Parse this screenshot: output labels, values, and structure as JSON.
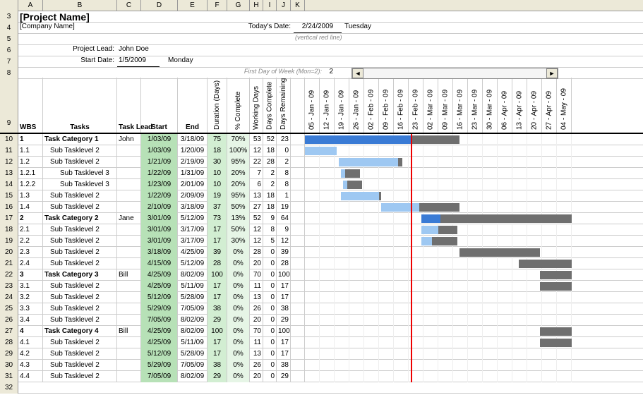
{
  "col_letters": [
    "A",
    "B",
    "C",
    "D",
    "E",
    "F",
    "G",
    "H",
    "I",
    "J",
    "K"
  ],
  "header": {
    "project_name": "[Project Name]",
    "company_name": "[Company Name]",
    "todays_date_label": "Today's Date:",
    "todays_date": "2/24/2009",
    "todays_day": "Tuesday",
    "vertical_note": "(vertical red line)",
    "project_lead_label": "Project Lead:",
    "project_lead": "John Doe",
    "start_date_label": "Start Date:",
    "start_date": "1/5/2009",
    "start_day": "Monday",
    "first_dow_label": "First Day of Week (Mon=2):",
    "first_dow_value": "2"
  },
  "columns": {
    "wbs": "WBS",
    "tasks": "Tasks",
    "task_lead": "Task Lead",
    "start": "Start",
    "end": "End",
    "duration": "Duration (Days)",
    "pct": "% Complete",
    "working": "Working Days",
    "dcomp": "Days Complete",
    "drem": "Days Remaining"
  },
  "date_cols": [
    "05 - Jan - 09",
    "12 - Jan - 09",
    "19 - Jan - 09",
    "26 - Jan - 09",
    "02 - Feb - 09",
    "09 - Feb - 09",
    "16 - Feb - 09",
    "23 - Feb - 09",
    "02 - Mar - 09",
    "09 - Mar - 09",
    "16 - Mar - 09",
    "23 - Mar - 09",
    "30 - Mar - 09",
    "06 - Apr - 09",
    "13 - Apr - 09",
    "20 - Apr - 09",
    "27 - Apr - 09",
    "04 - May - 09"
  ],
  "today_index": 7.14,
  "rows": [
    {
      "rn": 10,
      "wbs": "1",
      "task": "Task Category 1",
      "lead": "John",
      "start": "1/03/09",
      "end": "3/18/09",
      "dur": "75",
      "pct": "70%",
      "wd": "53",
      "dc": "52",
      "dr": "23",
      "cat": true,
      "bars": [
        {
          "s": -0.285,
          "e": 7.14,
          "cls": "bar-blue"
        },
        {
          "s": 7.14,
          "e": 10.43,
          "cls": "bar-dark"
        }
      ]
    },
    {
      "rn": 11,
      "wbs": "1.1",
      "task": "Sub Tasklevel 2",
      "lead": "",
      "start": "1/03/09",
      "end": "1/20/09",
      "dur": "18",
      "pct": "100%",
      "wd": "12",
      "dc": "18",
      "dr": "0",
      "indent": 1,
      "bars": [
        {
          "s": -0.285,
          "e": 2.14,
          "cls": "bar-light"
        }
      ]
    },
    {
      "rn": 12,
      "wbs": "1.2",
      "task": "Sub Tasklevel 2",
      "lead": "",
      "start": "1/21/09",
      "end": "2/19/09",
      "dur": "30",
      "pct": "95%",
      "wd": "22",
      "dc": "28",
      "dr": "2",
      "indent": 1,
      "bars": [
        {
          "s": 2.28,
          "e": 6.29,
          "cls": "bar-light"
        },
        {
          "s": 6.29,
          "e": 6.57,
          "cls": "bar-dark"
        }
      ]
    },
    {
      "rn": 13,
      "wbs": "1.2.1",
      "task": "Sub Tasklevel 3",
      "lead": "",
      "start": "1/22/09",
      "end": "1/31/09",
      "dur": "10",
      "pct": "20%",
      "wd": "7",
      "dc": "2",
      "dr": "8",
      "indent": 2,
      "bars": [
        {
          "s": 2.43,
          "e": 2.71,
          "cls": "bar-light"
        },
        {
          "s": 2.71,
          "e": 3.71,
          "cls": "bar-dark"
        }
      ]
    },
    {
      "rn": 14,
      "wbs": "1.2.2",
      "task": "Sub Tasklevel 3",
      "lead": "",
      "start": "1/23/09",
      "end": "2/01/09",
      "dur": "10",
      "pct": "20%",
      "wd": "6",
      "dc": "2",
      "dr": "8",
      "indent": 2,
      "bars": [
        {
          "s": 2.57,
          "e": 2.86,
          "cls": "bar-light"
        },
        {
          "s": 2.86,
          "e": 3.86,
          "cls": "bar-dark"
        }
      ]
    },
    {
      "rn": 15,
      "wbs": "1.3",
      "task": "Sub Tasklevel 2",
      "lead": "",
      "start": "1/22/09",
      "end": "2/09/09",
      "dur": "19",
      "pct": "95%",
      "wd": "13",
      "dc": "18",
      "dr": "1",
      "indent": 1,
      "bars": [
        {
          "s": 2.43,
          "e": 5.0,
          "cls": "bar-light"
        },
        {
          "s": 5.0,
          "e": 5.14,
          "cls": "bar-dark"
        }
      ]
    },
    {
      "rn": 16,
      "wbs": "1.4",
      "task": "Sub Tasklevel 2",
      "lead": "",
      "start": "2/10/09",
      "end": "3/18/09",
      "dur": "37",
      "pct": "50%",
      "wd": "27",
      "dc": "18",
      "dr": "19",
      "indent": 1,
      "bars": [
        {
          "s": 5.14,
          "e": 7.71,
          "cls": "bar-light"
        },
        {
          "s": 7.71,
          "e": 10.43,
          "cls": "bar-dark"
        }
      ]
    },
    {
      "rn": 17,
      "wbs": "2",
      "task": "Task Category 2",
      "lead": "Jane",
      "start": "3/01/09",
      "end": "5/12/09",
      "dur": "73",
      "pct": "13%",
      "wd": "52",
      "dc": "9",
      "dr": "64",
      "cat": true,
      "bars": [
        {
          "s": 7.86,
          "e": 9.14,
          "cls": "bar-blue"
        },
        {
          "s": 9.14,
          "e": 18.0,
          "cls": "bar-dark"
        }
      ]
    },
    {
      "rn": 18,
      "wbs": "2.1",
      "task": "Sub Tasklevel 2",
      "lead": "",
      "start": "3/01/09",
      "end": "3/17/09",
      "dur": "17",
      "pct": "50%",
      "wd": "12",
      "dc": "8",
      "dr": "9",
      "indent": 1,
      "bars": [
        {
          "s": 7.86,
          "e": 9.0,
          "cls": "bar-light"
        },
        {
          "s": 9.0,
          "e": 10.28,
          "cls": "bar-dark"
        }
      ]
    },
    {
      "rn": 19,
      "wbs": "2.2",
      "task": "Sub Tasklevel 2",
      "lead": "",
      "start": "3/01/09",
      "end": "3/17/09",
      "dur": "17",
      "pct": "30%",
      "wd": "12",
      "dc": "5",
      "dr": "12",
      "indent": 1,
      "bars": [
        {
          "s": 7.86,
          "e": 8.57,
          "cls": "bar-light"
        },
        {
          "s": 8.57,
          "e": 10.28,
          "cls": "bar-dark"
        }
      ]
    },
    {
      "rn": 20,
      "wbs": "2.3",
      "task": "Sub Tasklevel 2",
      "lead": "",
      "start": "3/18/09",
      "end": "4/25/09",
      "dur": "39",
      "pct": "0%",
      "wd": "28",
      "dc": "0",
      "dr": "39",
      "indent": 1,
      "bars": [
        {
          "s": 10.43,
          "e": 15.86,
          "cls": "bar-dark"
        }
      ]
    },
    {
      "rn": 21,
      "wbs": "2.4",
      "task": "Sub Tasklevel 2",
      "lead": "",
      "start": "4/15/09",
      "end": "5/12/09",
      "dur": "28",
      "pct": "0%",
      "wd": "20",
      "dc": "0",
      "dr": "28",
      "indent": 1,
      "bars": [
        {
          "s": 14.43,
          "e": 18.0,
          "cls": "bar-dark"
        }
      ]
    },
    {
      "rn": 22,
      "wbs": "3",
      "task": "Task Category 3",
      "lead": "Bill",
      "start": "4/25/09",
      "end": "8/02/09",
      "dur": "100",
      "pct": "0%",
      "wd": "70",
      "dc": "0",
      "dr": "100",
      "cat": true,
      "bars": [
        {
          "s": 15.86,
          "e": 18.0,
          "cls": "bar-dark"
        }
      ]
    },
    {
      "rn": 23,
      "wbs": "3.1",
      "task": "Sub Tasklevel 2",
      "lead": "",
      "start": "4/25/09",
      "end": "5/11/09",
      "dur": "17",
      "pct": "0%",
      "wd": "11",
      "dc": "0",
      "dr": "17",
      "indent": 1,
      "bars": [
        {
          "s": 15.86,
          "e": 18.0,
          "cls": "bar-dark"
        }
      ]
    },
    {
      "rn": 24,
      "wbs": "3.2",
      "task": "Sub Tasklevel 2",
      "lead": "",
      "start": "5/12/09",
      "end": "5/28/09",
      "dur": "17",
      "pct": "0%",
      "wd": "13",
      "dc": "0",
      "dr": "17",
      "indent": 1,
      "bars": []
    },
    {
      "rn": 25,
      "wbs": "3.3",
      "task": "Sub Tasklevel 2",
      "lead": "",
      "start": "5/29/09",
      "end": "7/05/09",
      "dur": "38",
      "pct": "0%",
      "wd": "26",
      "dc": "0",
      "dr": "38",
      "indent": 1,
      "bars": []
    },
    {
      "rn": 26,
      "wbs": "3.4",
      "task": "Sub Tasklevel 2",
      "lead": "",
      "start": "7/05/09",
      "end": "8/02/09",
      "dur": "29",
      "pct": "0%",
      "wd": "20",
      "dc": "0",
      "dr": "29",
      "indent": 1,
      "bars": []
    },
    {
      "rn": 27,
      "wbs": "4",
      "task": "Task Category 4",
      "lead": "Bill",
      "start": "4/25/09",
      "end": "8/02/09",
      "dur": "100",
      "pct": "0%",
      "wd": "70",
      "dc": "0",
      "dr": "100",
      "cat": true,
      "bars": [
        {
          "s": 15.86,
          "e": 18.0,
          "cls": "bar-dark"
        }
      ]
    },
    {
      "rn": 28,
      "wbs": "4.1",
      "task": "Sub Tasklevel 2",
      "lead": "",
      "start": "4/25/09",
      "end": "5/11/09",
      "dur": "17",
      "pct": "0%",
      "wd": "11",
      "dc": "0",
      "dr": "17",
      "indent": 1,
      "bars": [
        {
          "s": 15.86,
          "e": 18.0,
          "cls": "bar-dark"
        }
      ]
    },
    {
      "rn": 29,
      "wbs": "4.2",
      "task": "Sub Tasklevel 2",
      "lead": "",
      "start": "5/12/09",
      "end": "5/28/09",
      "dur": "17",
      "pct": "0%",
      "wd": "13",
      "dc": "0",
      "dr": "17",
      "indent": 1,
      "bars": []
    },
    {
      "rn": 30,
      "wbs": "4.3",
      "task": "Sub Tasklevel 2",
      "lead": "",
      "start": "5/29/09",
      "end": "7/05/09",
      "dur": "38",
      "pct": "0%",
      "wd": "26",
      "dc": "0",
      "dr": "38",
      "indent": 1,
      "bars": []
    },
    {
      "rn": 31,
      "wbs": "4.4",
      "task": "Sub Tasklevel 2",
      "lead": "",
      "start": "7/05/09",
      "end": "8/02/09",
      "dur": "29",
      "pct": "0%",
      "wd": "20",
      "dc": "0",
      "dr": "29",
      "indent": 1,
      "bars": []
    }
  ]
}
